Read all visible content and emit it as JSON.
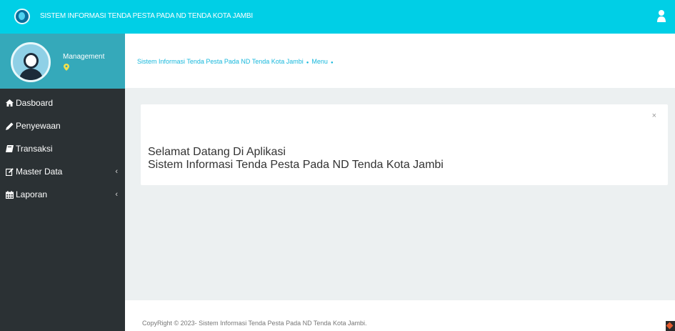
{
  "header": {
    "title": "SISTEM INFORMASI TENDA PESTA PADA ND TENDA KOTA JAMBI",
    "user_icon": "user-icon"
  },
  "sidebar": {
    "profile": {
      "role": "Management",
      "avatar": "avatar",
      "location_icon": "map-marker-icon"
    },
    "items": [
      {
        "label": "Dasboard",
        "icon": "home-icon",
        "has_submenu": false
      },
      {
        "label": "Penyewaan",
        "icon": "pencil-icon",
        "has_submenu": false
      },
      {
        "label": "Transaksi",
        "icon": "book-icon",
        "has_submenu": false
      },
      {
        "label": "Master Data",
        "icon": "edit-icon",
        "has_submenu": true
      },
      {
        "label": "Laporan",
        "icon": "calendar-icon",
        "has_submenu": true
      }
    ]
  },
  "breadcrumb": {
    "items": [
      "Sistem Informasi Tenda Pesta Pada ND Tenda Kota Jambi",
      "Menu"
    ]
  },
  "panel": {
    "close": "×",
    "line1": "Selamat Datang Di Aplikasi",
    "line2": "Sistem Informasi Tenda Pesta Pada ND Tenda Kota Jambi"
  },
  "footer": {
    "copyright": "CopyRight © 2023- Sistem Informasi Tenda Pesta Pada ND Tenda Kota Jambi."
  },
  "colors": {
    "header": "#00cfe6",
    "sidebar": "#2b3134",
    "profile": "#35a9ba",
    "content_bg": "#ecf0f1",
    "breadcrumb_text": "#17b8dc"
  }
}
